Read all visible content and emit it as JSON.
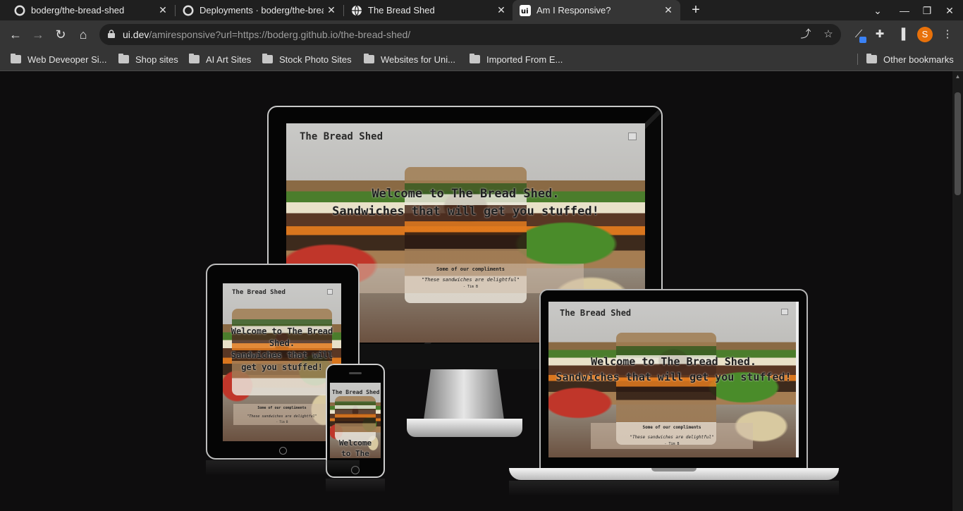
{
  "tabs": [
    {
      "title": "boderg/the-bread-shed",
      "icon": "github-icon"
    },
    {
      "title": "Deployments · boderg/the-bread-shed",
      "icon": "github-icon"
    },
    {
      "title": "The Bread Shed",
      "icon": "globe-icon"
    },
    {
      "title": "Am I Responsive?",
      "icon": "ui-dev-icon",
      "active": true
    }
  ],
  "omnibox": {
    "host": "ui.dev",
    "path": "/amiresponsive?url=https://boderg.github.io/the-bread-shed/"
  },
  "avatar_letter": "S",
  "bookmarks": [
    "Web Deveoper Si...",
    "Shop sites",
    "AI Art Sites",
    "Stock Photo Sites",
    "Websites for Uni...",
    "Imported From E..."
  ],
  "other_bookmarks": "Other bookmarks",
  "site": {
    "brand": "The Bread Shed",
    "hero": "Welcome to The Bread Shed.\nSandwiches that will get you stuffed!",
    "compliments_title": "Some of our compliments",
    "quote": "\"These sandwiches are delightful\"",
    "author": "- Tim B",
    "phone_hero": "Welcome\nto The"
  },
  "colors": {
    "page_bg": "#0e0d0e",
    "chrome": "#353535",
    "tabstrip": "#1f1f1f",
    "avatar": "#e8710a"
  }
}
